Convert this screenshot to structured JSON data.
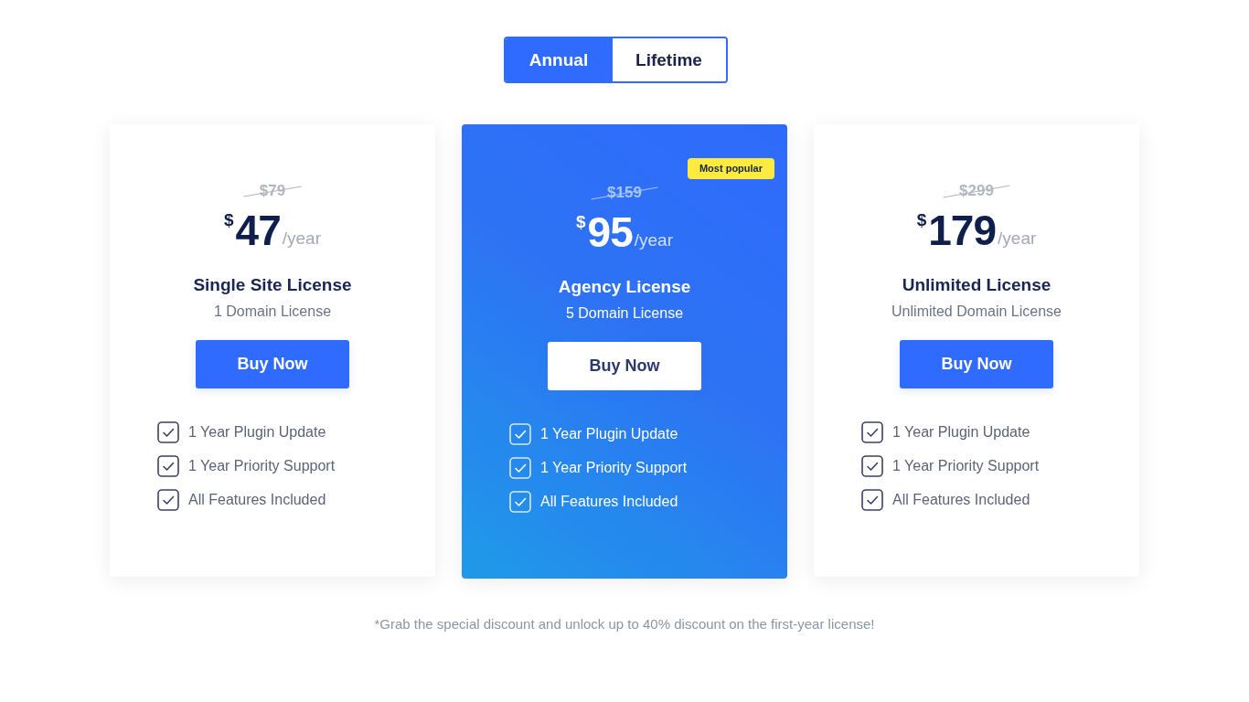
{
  "billing_toggle": [
    {
      "label": "Annual",
      "selected": true
    },
    {
      "label": "Lifetime",
      "selected": false
    }
  ],
  "plans": [
    {
      "featured": false,
      "old_price": "$79",
      "currency": "$",
      "amount": "47",
      "period": "/year",
      "name": "Single Site License",
      "domains": "1 Domain License",
      "button": "Buy Now",
      "features": [
        "1 Year Plugin Update",
        "1 Year Priority Support",
        "All Features Included"
      ]
    },
    {
      "featured": true,
      "badge": "Most popular",
      "old_price": "$159",
      "currency": "$",
      "amount": "95",
      "period": "/year",
      "name": "Agency License",
      "domains": "5 Domain License",
      "button": "Buy Now",
      "features": [
        "1 Year Plugin Update",
        "1 Year Priority Support",
        "All Features Included"
      ]
    },
    {
      "featured": false,
      "old_price": "$299",
      "currency": "$",
      "amount": "179",
      "period": "/year",
      "name": "Unlimited License",
      "domains": "Unlimited Domain License",
      "button": "Buy Now",
      "features": [
        "1 Year Plugin Update",
        "1 Year Priority Support",
        "All Features Included"
      ]
    }
  ],
  "footnote": "*Grab the special discount and unlock up to 40% discount on the first-year license!"
}
